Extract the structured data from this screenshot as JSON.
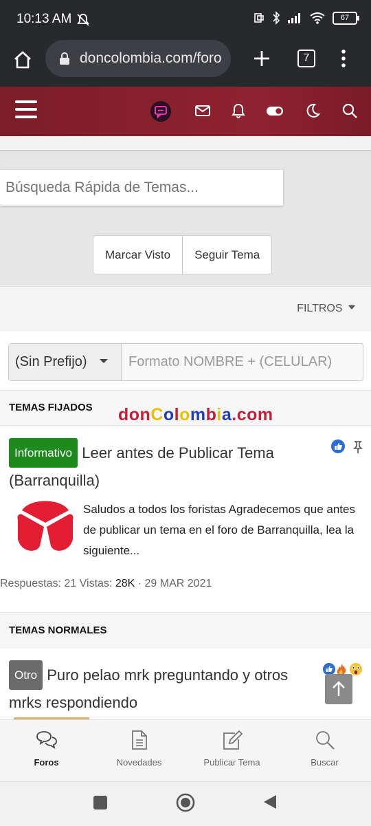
{
  "status_bar": {
    "time": "10:13 AM",
    "battery": "67"
  },
  "browser": {
    "url": "doncolombia.com/foro",
    "tab_count": "7"
  },
  "site_header": {
    "icons": [
      "menu-icon",
      "chat-icon",
      "mail-icon",
      "bell-icon",
      "toggle-icon",
      "moon-icon",
      "search-icon"
    ]
  },
  "search": {
    "placeholder": "Búsqueda Rápida de Temas..."
  },
  "buttons": {
    "mark_seen": "Marcar Visto",
    "follow": "Seguir Tema"
  },
  "filters": {
    "label": "FILTROS"
  },
  "prefix": {
    "selected": "(Sin Prefijo)",
    "placeholder": "Formato NOMBRE + (CELULAR)"
  },
  "sections": {
    "pinned": "TEMAS FIJADOS",
    "normal": "TEMAS NORMALES"
  },
  "watermark": {
    "text": "donColombia.com"
  },
  "threads": [
    {
      "prefix": "Informativo",
      "prefix_color": "#1e8a1e",
      "title": "Leer antes de Publicar Tema (Barranquilla)",
      "excerpt": "Saludos a todos los foristas Agradecemos que antes de publicar un tema en el foro de Barranquilla, lea la siguiente...",
      "replies_label": "Respuestas:",
      "replies": "21",
      "views_label": "Vistas:",
      "views": "28K",
      "date": "29 MAR 2021"
    },
    {
      "prefix": "Otro",
      "prefix_color": "#6b6b6b",
      "title": "Puro pelao mrk preguntando y otros mrks respondiendo"
    }
  ],
  "bottom_nav": [
    {
      "label": "Foros",
      "icon": "chat-bubbles-icon",
      "active": true
    },
    {
      "label": "Novedades",
      "icon": "document-icon"
    },
    {
      "label": "Publicar Tema",
      "icon": "edit-icon"
    },
    {
      "label": "Buscar",
      "icon": "search-icon"
    }
  ],
  "colors": {
    "header": "#8f2230",
    "chrome": "#27292d"
  }
}
